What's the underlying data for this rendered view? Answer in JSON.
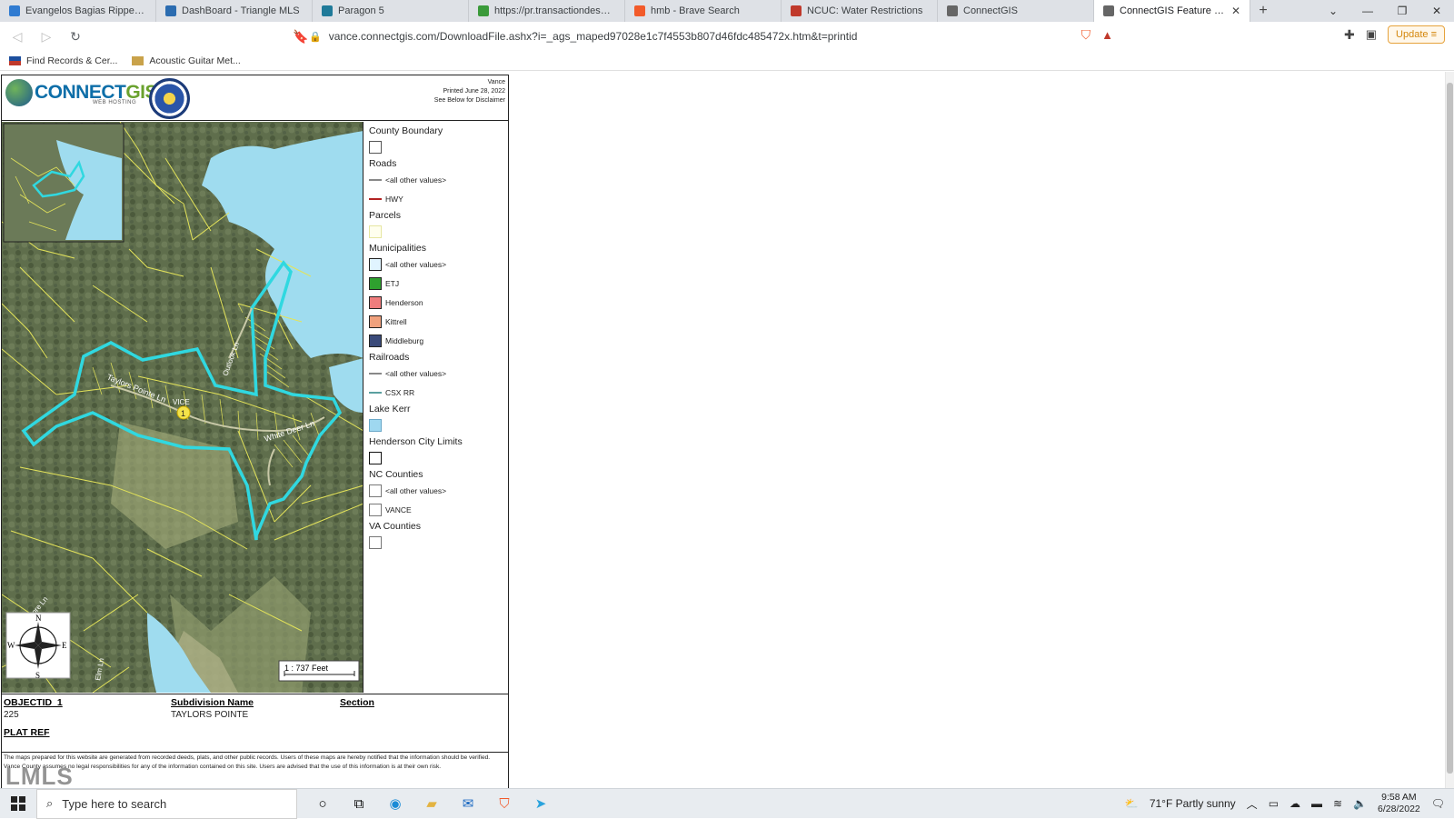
{
  "browser": {
    "tabs": [
      {
        "title": "Evangelos Bagias Rippey Family",
        "icon": "n-icon",
        "color": "#2f7bd1"
      },
      {
        "title": "DashBoard - Triangle MLS",
        "icon": "mls-icon",
        "color": "#2b6cb0"
      },
      {
        "title": "Paragon 5",
        "icon": "paragon-icon",
        "color": "#1f7a99"
      },
      {
        "title": "https://pr.transactiondesk.com/",
        "icon": "transactiondesk-icon",
        "color": "#3a9a3a"
      },
      {
        "title": "hmb - Brave Search",
        "icon": "brave-icon",
        "color": "#f25a2a"
      },
      {
        "title": "NCUC: Water Restrictions",
        "icon": "flag-icon",
        "color": "#c0392b"
      },
      {
        "title": "ConnectGIS",
        "icon": "globe-icon",
        "color": "#666666"
      },
      {
        "title": "ConnectGIS Feature Report",
        "icon": "globe-icon",
        "color": "#666666",
        "active": true
      }
    ],
    "new_tab": "+",
    "url": "vance.connectgis.com/DownloadFile.ashx?i=_ags_maped97028e1c7f4553b807d46fdc485472x.htm&t=printid",
    "update_label": "Update",
    "bookmarks": [
      {
        "label": "Find Records & Cer..."
      },
      {
        "label": "Acoustic Guitar Met..."
      }
    ]
  },
  "report": {
    "logo_main": "CONNECT",
    "logo_accent": "GIS",
    "logo_sub": "WEB HOSTING",
    "print_county": "Vance",
    "print_date": "Printed June 28, 2022",
    "print_disclaimer": "See Below for Disclaimer",
    "scale_label": "1 : 737 Feet",
    "compass": {
      "n": "N",
      "s": "S",
      "e": "E",
      "w": "W"
    },
    "map_labels": {
      "road1": "Taylors Pointe Ln",
      "road2": "White Deer Ln",
      "road3": "Outlook Ln",
      "road4": "Shore Ln",
      "road5": "Elm Ln",
      "marker": "1",
      "site": "VICE"
    },
    "legend": [
      {
        "title": "County Boundary",
        "items": [
          {
            "kind": "box",
            "label": "",
            "color": "#ffffff",
            "border": "#555555"
          }
        ]
      },
      {
        "title": "Roads",
        "items": [
          {
            "kind": "line",
            "label": "<all other values>",
            "color": "#888888"
          },
          {
            "kind": "line",
            "label": "HWY",
            "color": "#b22222"
          }
        ]
      },
      {
        "title": "Parcels",
        "items": [
          {
            "kind": "box",
            "label": "",
            "color": "#ffffee",
            "border": "#e6e6a0"
          }
        ]
      },
      {
        "title": "Municipalities",
        "items": [
          {
            "kind": "box",
            "label": "<all other values>",
            "color": "#e0f4ff",
            "border": "#222222"
          },
          {
            "kind": "box",
            "label": "ETJ",
            "color": "#2fa12f",
            "border": "#222222"
          },
          {
            "kind": "box",
            "label": "Henderson",
            "color": "#f07d7d",
            "border": "#222222"
          },
          {
            "kind": "box",
            "label": "Kittrell",
            "color": "#f0a17d",
            "border": "#222222"
          },
          {
            "kind": "box",
            "label": "Middleburg",
            "color": "#3a4a7a",
            "border": "#222222"
          }
        ]
      },
      {
        "title": "Railroads",
        "items": [
          {
            "kind": "line",
            "label": "<all other values>",
            "color": "#888888"
          },
          {
            "kind": "line",
            "label": "CSX RR",
            "color": "#5aa0a0"
          }
        ]
      },
      {
        "title": "Lake Kerr",
        "items": [
          {
            "kind": "box",
            "label": "",
            "color": "#9fd8f0",
            "border": "#6aa8c8"
          }
        ]
      },
      {
        "title": "Henderson City Limits",
        "items": [
          {
            "kind": "box",
            "label": "",
            "color": "#ffffff",
            "border": "#111111"
          }
        ]
      },
      {
        "title": "NC Counties",
        "items": [
          {
            "kind": "box",
            "label": "<all other values>",
            "color": "#ffffff",
            "border": "#777777"
          },
          {
            "kind": "box",
            "label": "VANCE",
            "color": "#ffffff",
            "border": "#777777"
          }
        ]
      },
      {
        "title": "VA Counties",
        "items": [
          {
            "kind": "box",
            "label": "",
            "color": "#ffffff",
            "border": "#777777"
          }
        ]
      }
    ],
    "attributes": {
      "objectid_h": "OBJECTID_1",
      "objectid_v": "225",
      "subdivision_h": "Subdivision Name",
      "subdivision_v": "TAYLORS POINTE",
      "section_h": "Section",
      "platref_h": "PLAT REF"
    },
    "disclaimer": "The maps prepared for this website are generated from recorded deeds, plats, and other public records. Users of these maps are hereby notified that the information should be verified. Vance County assumes no legal responsibilities for any of the information contained on this site. Users are advised that the use of this information is at their own risk.",
    "watermark": "LMLS"
  },
  "taskbar": {
    "search_placeholder": "Type here to search",
    "weather": "71°F  Partly sunny",
    "time": "9:58 AM",
    "date": "6/28/2022"
  }
}
